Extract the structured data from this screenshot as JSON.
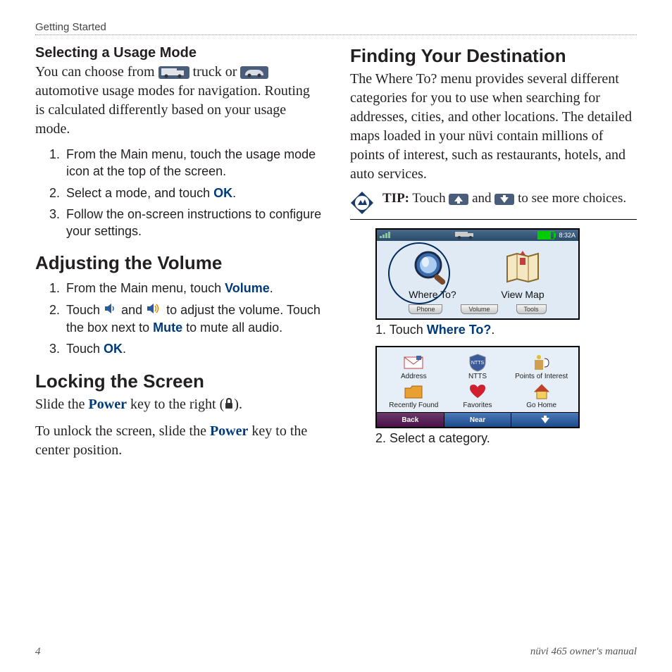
{
  "header": {
    "section": "Getting Started"
  },
  "left": {
    "usage": {
      "heading": "Selecting a Usage Mode",
      "p_a": "You can choose from ",
      "p_b": " truck or ",
      "p_c": " automotive usage modes for navigation. Routing is calculated differently based on your usage mode.",
      "steps": {
        "s1": "From the Main menu, touch the usage mode icon at the top of the screen.",
        "s2a": "Select a mode, and touch ",
        "s2b": "OK",
        "s2c": ".",
        "s3": "Follow the on-screen instructions to configure your settings."
      }
    },
    "volume": {
      "heading": "Adjusting the Volume",
      "s1a": "From the Main menu, touch ",
      "s1b": "Volume",
      "s1c": ".",
      "s2a": "Touch ",
      "s2b": " and ",
      "s2c": " to adjust the volume. Touch the box next to ",
      "s2d": "Mute",
      "s2e": " to mute all audio.",
      "s3a": "Touch ",
      "s3b": "OK",
      "s3c": "."
    },
    "lock": {
      "heading": "Locking the Screen",
      "p1a": "Slide the ",
      "p1b": "Power",
      "p1c": " key to the right (",
      "p1d": ").",
      "p2a": "To unlock the screen, slide the ",
      "p2b": "Power",
      "p2c": " key to the center position."
    }
  },
  "right": {
    "heading": "Finding Your Destination",
    "intro": "The Where To? menu provides several different categories for you to use when searching for addresses, cities, and other locations. The detailed maps loaded in your nüvi contain millions of points of interest, such as restaurants, hotels, and auto services.",
    "tip": {
      "label": "TIP:",
      "a": " Touch ",
      "b": " and ",
      "c": " to see more choices."
    },
    "screen1": {
      "time": "8:32A",
      "where": "Where To?",
      "viewmap": "View Map",
      "tabs": {
        "phone": "Phone",
        "volume": "Volume",
        "tools": "Tools"
      }
    },
    "cap1a": "1.   Touch ",
    "cap1b": "Where To?",
    "cap1c": ".",
    "screen2": {
      "cells": {
        "address": "Address",
        "ntts": "NTTS",
        "poi": "Points of Interest",
        "recent": "Recently Found",
        "fav": "Favorites",
        "home": "Go Home"
      },
      "back": "Back",
      "near": "Near"
    },
    "cap2": "2.   Select a category."
  },
  "footer": {
    "page": "4",
    "title": "nüvi 465 owner's manual"
  }
}
